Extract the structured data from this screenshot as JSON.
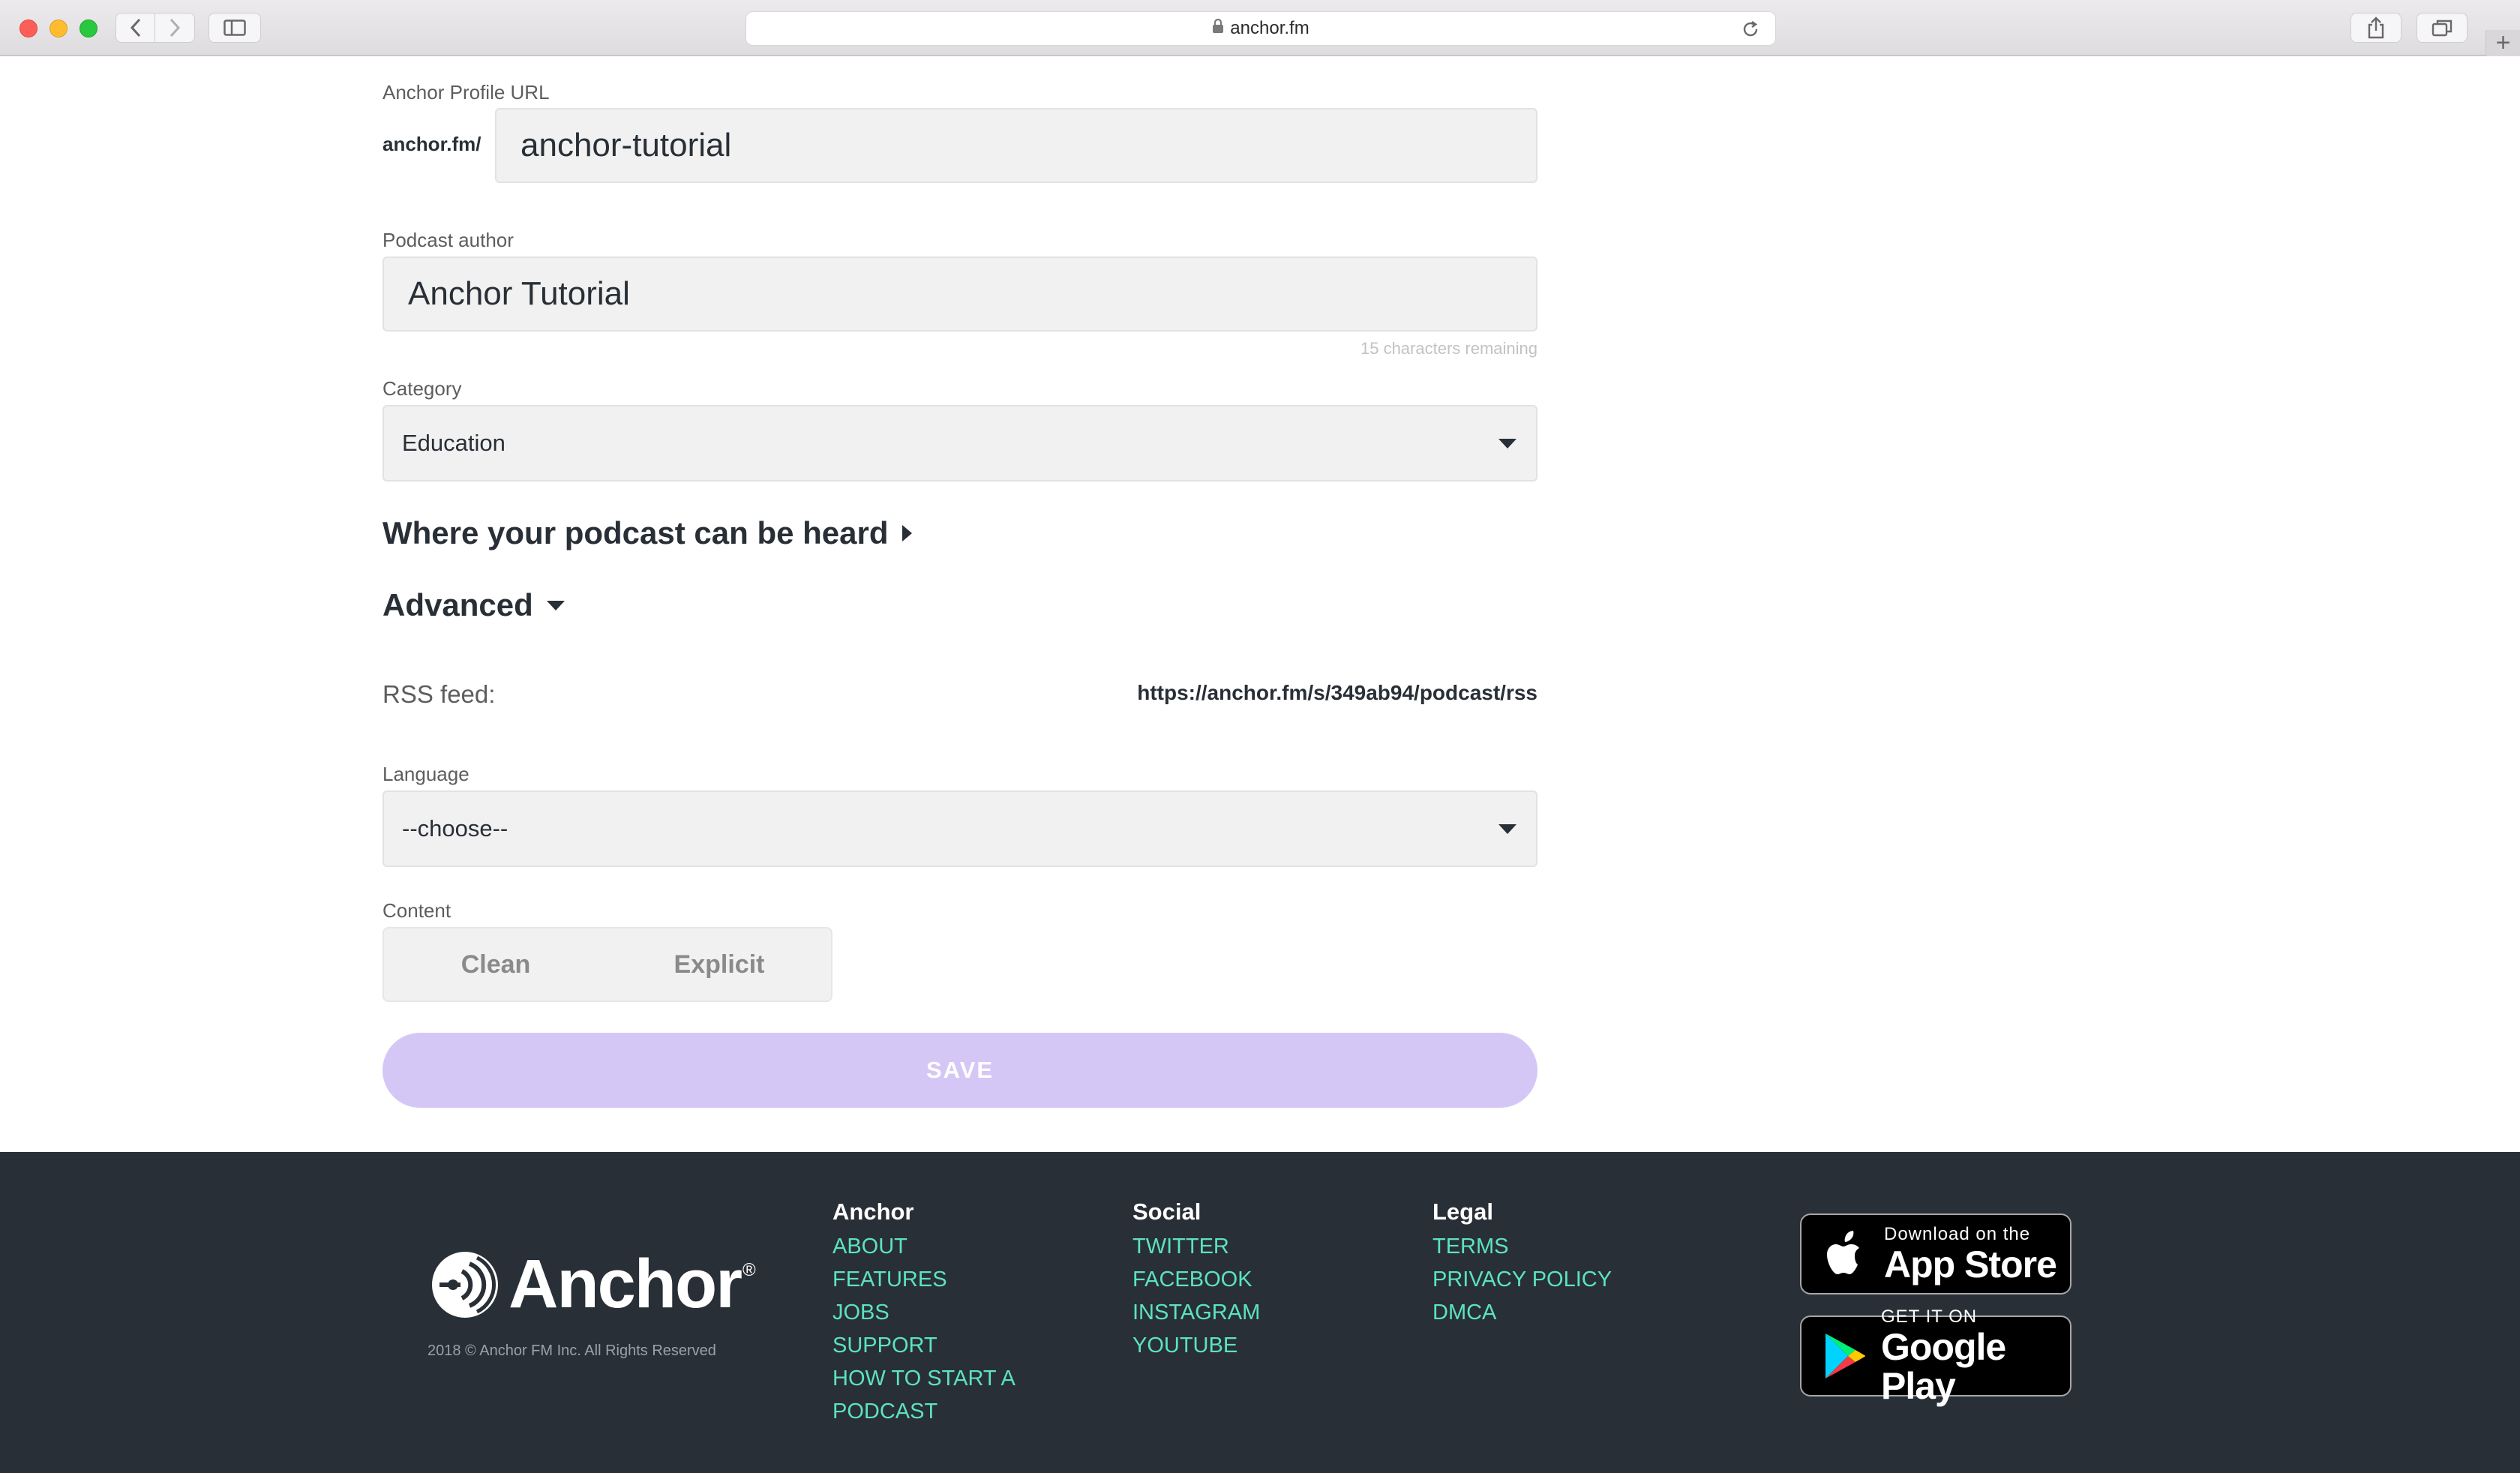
{
  "browser": {
    "url": "anchor.fm"
  },
  "form": {
    "profile_url": {
      "label": "Anchor Profile URL",
      "prefix": "anchor.fm/",
      "value": "anchor-tutorial"
    },
    "author": {
      "label": "Podcast author",
      "value": "Anchor Tutorial",
      "hint": "15 characters remaining"
    },
    "category": {
      "label": "Category",
      "selected": "Education"
    },
    "where_heard": {
      "label": "Where your podcast can be heard"
    },
    "advanced": {
      "label": "Advanced"
    },
    "rss": {
      "label": "RSS feed:",
      "url": "https://anchor.fm/s/349ab94/podcast/rss"
    },
    "language": {
      "label": "Language",
      "selected": "--choose--"
    },
    "content": {
      "label": "Content",
      "options": [
        "Clean",
        "Explicit"
      ]
    },
    "save_label": "SAVE"
  },
  "footer": {
    "brand": "Anchor",
    "registered": "®",
    "copyright": "2018 © Anchor FM Inc. All Rights Reserved",
    "columns": {
      "anchor": {
        "title": "Anchor",
        "links": [
          "ABOUT",
          "FEATURES",
          "JOBS",
          "SUPPORT",
          "HOW TO START A",
          "PODCAST"
        ]
      },
      "social": {
        "title": "Social",
        "links": [
          "TWITTER",
          "FACEBOOK",
          "INSTAGRAM",
          "YOUTUBE"
        ]
      },
      "legal": {
        "title": "Legal",
        "links": [
          "TERMS",
          "PRIVACY POLICY",
          "DMCA"
        ]
      }
    },
    "app_store": {
      "small": "Download on the",
      "large": "App Store"
    },
    "google_play": {
      "small": "GET IT ON",
      "large": "Google Play"
    }
  },
  "colors": {
    "link": "#5ce2c2",
    "footer_bg": "#292f36",
    "save_bg": "#d5c7f5"
  }
}
